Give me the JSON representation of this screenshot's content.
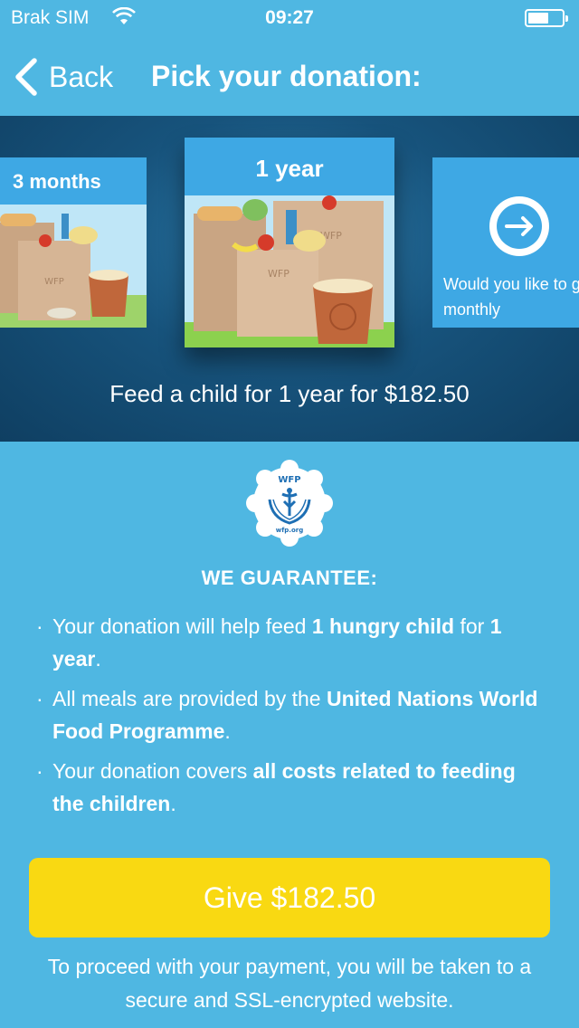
{
  "status_bar": {
    "carrier": "Brak SIM",
    "time": "09:27",
    "icons": [
      "wifi-icon",
      "battery-icon"
    ]
  },
  "nav": {
    "back_label": "Back",
    "title": "Pick your donation:",
    "icons": [
      "chevron-left-icon"
    ]
  },
  "carousel": {
    "cards": [
      {
        "label": "3 months"
      },
      {
        "label": "1 year"
      },
      {
        "label": "Would you like to give monthly",
        "icon": "arrow-right-circle-icon"
      }
    ],
    "description": "Feed a child for 1 year for $182.50"
  },
  "guarantee": {
    "logo": {
      "top_text": "WFP",
      "bottom_text": "wfp.org"
    },
    "title": "WE GUARANTEE:",
    "items": [
      [
        {
          "t": "Your donation will help feed ",
          "b": false
        },
        {
          "t": "1 hungry child",
          "b": true
        },
        {
          "t": " for ",
          "b": false
        },
        {
          "t": "1 year",
          "b": true
        },
        {
          "t": ".",
          "b": false
        }
      ],
      [
        {
          "t": "All meals are provided by the ",
          "b": false
        },
        {
          "t": "United Nations World Food Programme",
          "b": true
        },
        {
          "t": ".",
          "b": false
        }
      ],
      [
        {
          "t": "Your donation covers ",
          "b": false
        },
        {
          "t": "all costs related to feeding the children",
          "b": true
        },
        {
          "t": ".",
          "b": false
        }
      ]
    ]
  },
  "give_button": {
    "label": "Give $182.50"
  },
  "disclaimer": "To proceed with your payment, you will be taken to a secure and SSL-encrypted website.",
  "colors": {
    "background": "#4fb7e2",
    "carousel_bg": "#17537c",
    "card_header": "#3ea8e4",
    "give_button": "#f9d912"
  }
}
